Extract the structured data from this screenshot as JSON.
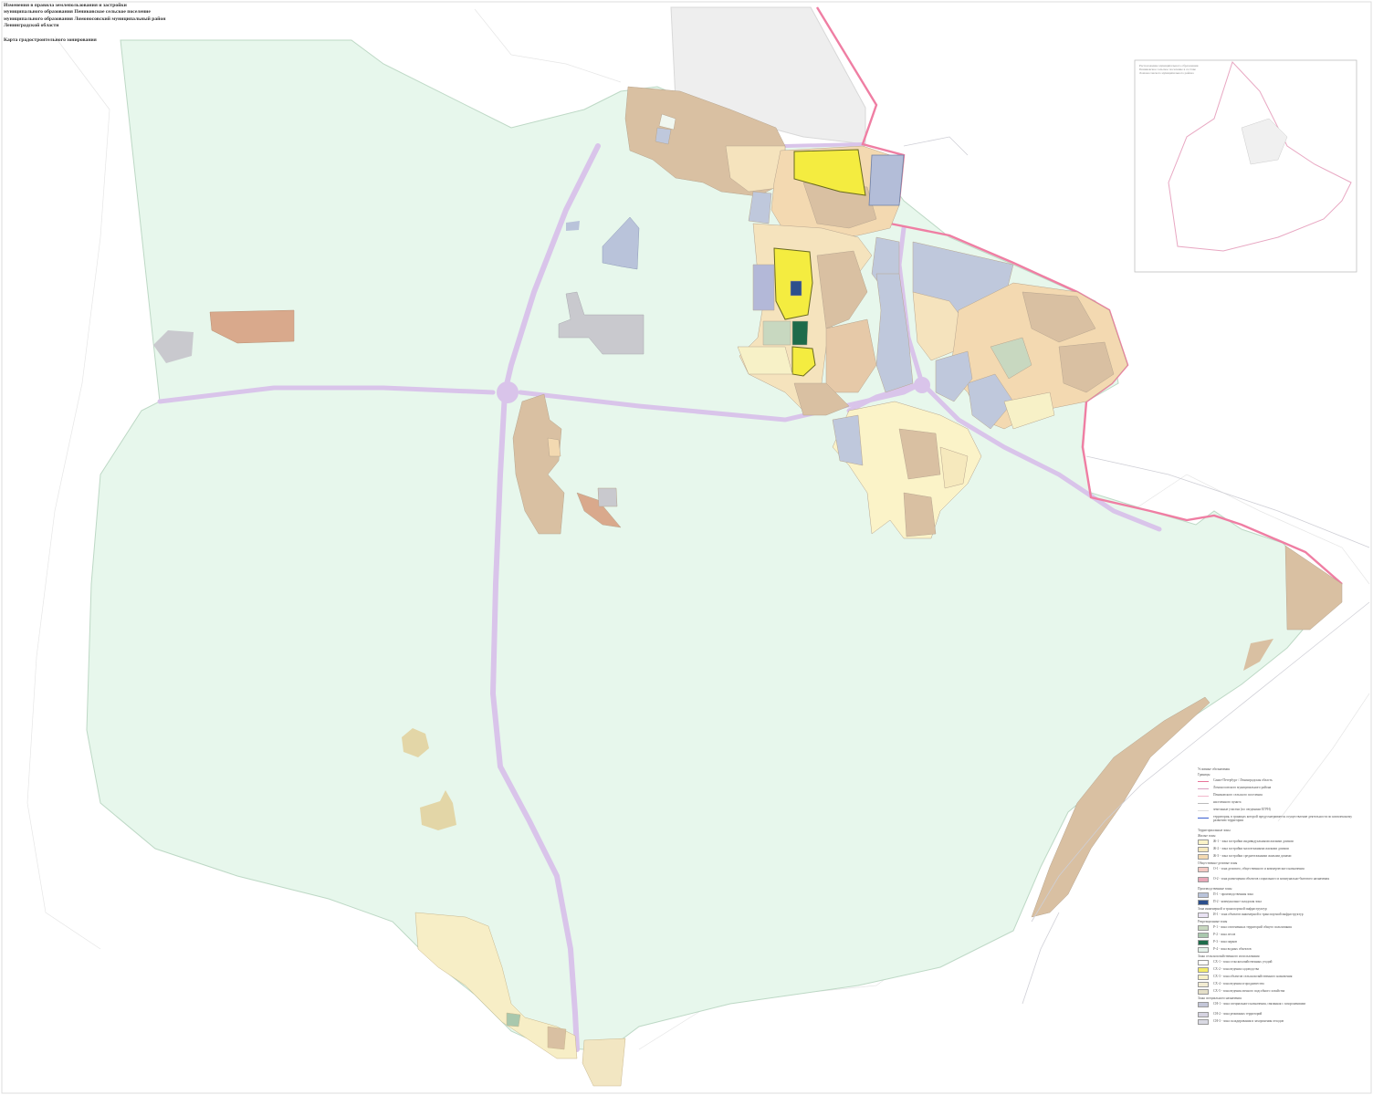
{
  "title": {
    "lines": [
      "Изменения в правила землепользования и застройки",
      "муниципального образования Пениковское сельское поселение",
      "муниципального образования Ломоносовский муниципальный район",
      "Ленинградской области"
    ],
    "map_name": "Карта градостроительного зонирования"
  },
  "inset": {
    "caption": "Расположение муниципального образования Пениковское сельское поселение в составе Ломоносовского муниципального района"
  },
  "legend": {
    "title": "Условные обозначения",
    "borders_heading": "Границы",
    "borders": [
      {
        "label": "Санкт-Петербург / Ленинградская область",
        "color": "#e8749a"
      },
      {
        "label": "Ломоносовского муниципального района",
        "color": "#d9a0c0"
      },
      {
        "label": "Пениковского сельского поселения",
        "color": "#f2b8cc"
      },
      {
        "label": "населенного пункта",
        "color": "#bbbbbb"
      },
      {
        "label": "земельные участки (по сведениям ЕГРН)",
        "color": "#dddddd"
      },
      {
        "label": "территория, в границах которой предусматривается осуществление деятельности по комплексному развитию территории",
        "color": "#3a5fd0"
      }
    ],
    "zones_heading": "Территориальные зоны",
    "groups": [
      {
        "heading": "Жилые зоны",
        "items": [
          {
            "code": "Ж-1",
            "label": "зона застройки индивидуальными жилыми домами",
            "color": "#fbf3c8"
          },
          {
            "code": "Ж-2",
            "label": "зона застройки малоэтажными жилыми домами",
            "color": "#f6e9bd"
          },
          {
            "code": "Ж-3",
            "label": "зона застройки среднеэтажными жилыми домами",
            "color": "#f3d9b1"
          }
        ]
      },
      {
        "heading": "Общественно-деловые зоны",
        "items": [
          {
            "code": "О-1",
            "label": "зона делового, общественного и коммерческого назначения",
            "color": "#f3c9c3"
          },
          {
            "code": "О-2",
            "label": "зона размещения объектов социального и коммунально-бытового назначения",
            "color": "#e8a7b8"
          }
        ]
      },
      {
        "heading": "Производственные зоны",
        "items": [
          {
            "code": "П-1",
            "label": "производственная зона",
            "color": "#b9c3da"
          },
          {
            "code": "П-2",
            "label": "коммунально-складская зона",
            "color": "#2c4f8c"
          }
        ]
      },
      {
        "heading": "Зона инженерной и транспортной инфраструктур",
        "items": [
          {
            "code": "И-1",
            "label": "зона объектов инженерной и транспортной инфраструктур",
            "color": "#e9e2f3"
          }
        ]
      },
      {
        "heading": "Рекреационные зоны",
        "items": [
          {
            "code": "Р-1",
            "label": "зона озелененных территорий общего пользования",
            "color": "#c8d8c0"
          },
          {
            "code": "Р-2",
            "label": "зона лесов",
            "color": "#a9c8ad"
          },
          {
            "code": "Р-3",
            "label": "зона парков",
            "color": "#1e6b4a"
          },
          {
            "code": "Р-4",
            "label": "зона водных объектов",
            "color": "#e4f1ea"
          }
        ]
      },
      {
        "heading": "Зоны сельскохозяйственного использования",
        "items": [
          {
            "code": "СХ-1",
            "label": "зона сельскохозяйственных угодий",
            "color": "#ffffff"
          },
          {
            "code": "СХ-2",
            "label": "зона ведения садоводства",
            "color": "#f4ec6a"
          },
          {
            "code": "СХ-3",
            "label": "зона объектов сельскохозяйственного назначения",
            "color": "#f7f1c7"
          },
          {
            "code": "СХ-4",
            "label": "зона ведения огородничества",
            "color": "#f2ecd2"
          },
          {
            "code": "СХ-5",
            "label": "зона ведения личного подсобного хозяйства",
            "color": "#e4dfc8"
          }
        ]
      },
      {
        "heading": "Зоны специального назначения",
        "items": [
          {
            "code": "СН-1",
            "label": "зона специального назначения, связанная с захоронениями",
            "color": "#c3c6d8"
          },
          {
            "code": "СН-2",
            "label": "зона режимных территорий",
            "color": "#d5d3e1"
          },
          {
            "code": "СН-3",
            "label": "зона складирования и захоронения отходов",
            "color": "#d9d9e3"
          }
        ]
      }
    ]
  },
  "colors": {
    "forest": "#e7f7ec",
    "agri_tan": "#d9c0a2",
    "residential": "#f5e3bd",
    "industrial": "#bfc8dc",
    "garden_yellow": "#f4ec40",
    "road": "#d9c4ea",
    "boundary_pink": "#ef7ea3",
    "water_dark": "#2c4f8c",
    "park_dark": "#1e6b4a",
    "special_gray": "#c9c9ce"
  }
}
